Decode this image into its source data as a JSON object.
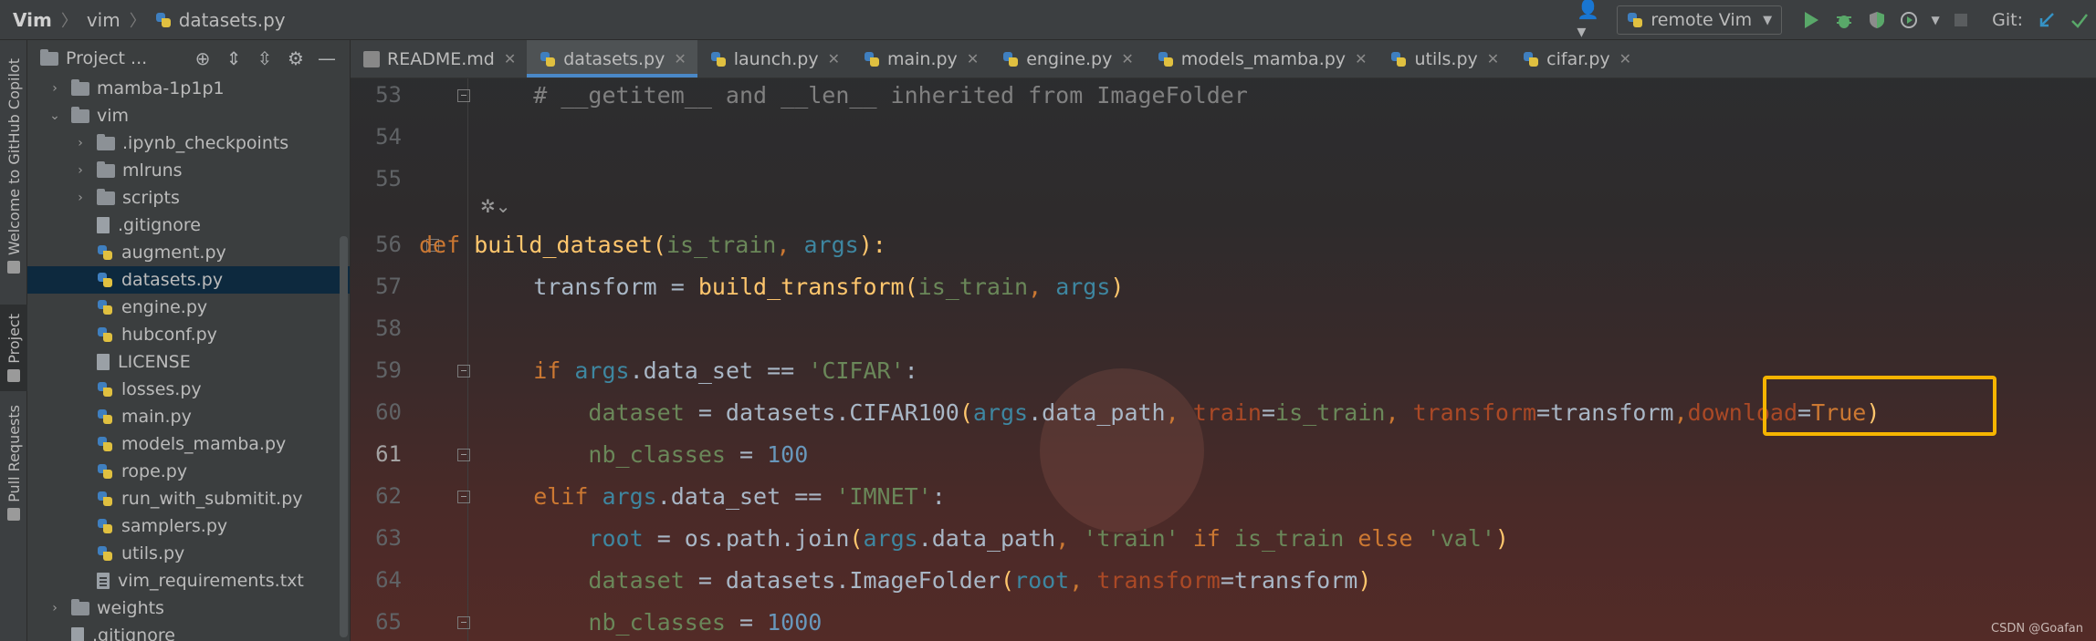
{
  "navbar": {
    "breadcrumbs": [
      "Vim",
      "vim",
      "datasets.py"
    ],
    "run_config": "remote Vim",
    "git_label": "Git:"
  },
  "toolwindows": {
    "left": [
      "Welcome to GitHub Copilot",
      "Project",
      "Pull Requests"
    ]
  },
  "project_panel": {
    "title": "Project ...",
    "tree": [
      {
        "label": "mamba-1p1p1",
        "type": "folder",
        "depth": 1,
        "expanded": false
      },
      {
        "label": "vim",
        "type": "folder",
        "depth": 1,
        "expanded": true
      },
      {
        "label": ".ipynb_checkpoints",
        "type": "folder",
        "depth": 2,
        "expanded": false
      },
      {
        "label": "mlruns",
        "type": "folder",
        "depth": 2,
        "expanded": false
      },
      {
        "label": "scripts",
        "type": "folder",
        "depth": 2,
        "expanded": false
      },
      {
        "label": ".gitignore",
        "type": "file",
        "depth": 2
      },
      {
        "label": "augment.py",
        "type": "py",
        "depth": 2
      },
      {
        "label": "datasets.py",
        "type": "py",
        "depth": 2,
        "selected": true
      },
      {
        "label": "engine.py",
        "type": "py",
        "depth": 2
      },
      {
        "label": "hubconf.py",
        "type": "py",
        "depth": 2
      },
      {
        "label": "LICENSE",
        "type": "file",
        "depth": 2
      },
      {
        "label": "losses.py",
        "type": "py",
        "depth": 2
      },
      {
        "label": "main.py",
        "type": "py",
        "depth": 2
      },
      {
        "label": "models_mamba.py",
        "type": "py",
        "depth": 2
      },
      {
        "label": "rope.py",
        "type": "py",
        "depth": 2
      },
      {
        "label": "run_with_submitit.py",
        "type": "py",
        "depth": 2
      },
      {
        "label": "samplers.py",
        "type": "py",
        "depth": 2
      },
      {
        "label": "utils.py",
        "type": "py",
        "depth": 2
      },
      {
        "label": "vim_requirements.txt",
        "type": "txt",
        "depth": 2
      },
      {
        "label": "weights",
        "type": "folder",
        "depth": 1,
        "expanded": false
      },
      {
        "label": ".gitignore",
        "type": "file",
        "depth": 1
      }
    ]
  },
  "tabs": [
    {
      "label": "README.md",
      "icon": "markdown-icon"
    },
    {
      "label": "datasets.py",
      "icon": "python-icon",
      "active": true
    },
    {
      "label": "launch.py",
      "icon": "python-icon"
    },
    {
      "label": "main.py",
      "icon": "python-icon"
    },
    {
      "label": "engine.py",
      "icon": "python-icon"
    },
    {
      "label": "models_mamba.py",
      "icon": "python-icon"
    },
    {
      "label": "utils.py",
      "icon": "python-icon"
    },
    {
      "label": "cifar.py",
      "icon": "python-icon"
    }
  ],
  "code": {
    "current_line": 61,
    "lines": [
      {
        "n": 53,
        "tokens": [
          [
            "    ",
            "plain"
          ],
          [
            "# __getitem__ and __len__ inherited from ImageFolder",
            "com"
          ]
        ]
      },
      {
        "n": 54,
        "tokens": []
      },
      {
        "n": 55,
        "tokens": []
      },
      {
        "n": 56,
        "tokens": [
          [
            "def ",
            "kw"
          ],
          [
            "build_dataset",
            "fn"
          ],
          [
            "(",
            "fn"
          ],
          [
            "is_train",
            "param"
          ],
          [
            ", ",
            "kw"
          ],
          [
            "args",
            "argv"
          ],
          [
            "):",
            "fn"
          ]
        ]
      },
      {
        "n": 57,
        "tokens": [
          [
            "    transform = ",
            "plain"
          ],
          [
            "build_transform",
            "fn"
          ],
          [
            "(",
            "fn"
          ],
          [
            "is_train",
            "param"
          ],
          [
            ", ",
            "kw"
          ],
          [
            "args",
            "argv"
          ],
          [
            ")",
            "fn"
          ]
        ]
      },
      {
        "n": 58,
        "tokens": []
      },
      {
        "n": 59,
        "tokens": [
          [
            "    ",
            "plain"
          ],
          [
            "if ",
            "kw"
          ],
          [
            "args",
            "argv"
          ],
          [
            ".data_set == ",
            "plain"
          ],
          [
            "'CIFAR'",
            "str"
          ],
          [
            ":",
            "plain"
          ]
        ]
      },
      {
        "n": 60,
        "tokens": [
          [
            "        ",
            "plain"
          ],
          [
            "dataset",
            "param"
          ],
          [
            " = datasets.CIFAR100",
            "plain"
          ],
          [
            "(",
            "fn"
          ],
          [
            "args",
            "argv"
          ],
          [
            ".data_path",
            "plain"
          ],
          [
            ", ",
            "kw"
          ],
          [
            "train",
            "named"
          ],
          [
            "=",
            "plain"
          ],
          [
            "is_train",
            "param"
          ],
          [
            ", ",
            "kw"
          ],
          [
            "transform",
            "named"
          ],
          [
            "=transform",
            "plain"
          ],
          [
            ",",
            "kw"
          ],
          [
            "download",
            "named"
          ],
          [
            "=",
            "plain"
          ],
          [
            "True",
            "kw"
          ],
          [
            ")",
            "fn"
          ]
        ]
      },
      {
        "n": 61,
        "tokens": [
          [
            "        ",
            "plain"
          ],
          [
            "nb_classes",
            "param"
          ],
          [
            " = ",
            "plain"
          ],
          [
            "100",
            "num"
          ]
        ]
      },
      {
        "n": 62,
        "tokens": [
          [
            "    ",
            "plain"
          ],
          [
            "elif ",
            "kw"
          ],
          [
            "args",
            "argv"
          ],
          [
            ".data_set == ",
            "plain"
          ],
          [
            "'IMNET'",
            "str"
          ],
          [
            ":",
            "plain"
          ]
        ]
      },
      {
        "n": 63,
        "tokens": [
          [
            "        ",
            "plain"
          ],
          [
            "root",
            "argv"
          ],
          [
            " = os.path.join",
            "plain"
          ],
          [
            "(",
            "fn"
          ],
          [
            "args",
            "argv"
          ],
          [
            ".data_path",
            "plain"
          ],
          [
            ", ",
            "kw"
          ],
          [
            "'train'",
            "str"
          ],
          [
            " if ",
            "kw"
          ],
          [
            "is_train",
            "param"
          ],
          [
            " else ",
            "kw"
          ],
          [
            "'val'",
            "str"
          ],
          [
            ")",
            "fn"
          ]
        ]
      },
      {
        "n": 64,
        "tokens": [
          [
            "        ",
            "plain"
          ],
          [
            "dataset",
            "param"
          ],
          [
            " = datasets.ImageFolder",
            "plain"
          ],
          [
            "(",
            "fn"
          ],
          [
            "root",
            "argv"
          ],
          [
            ", ",
            "kw"
          ],
          [
            "transform",
            "named"
          ],
          [
            "=transform",
            "plain"
          ],
          [
            ")",
            "fn"
          ]
        ]
      },
      {
        "n": 65,
        "tokens": [
          [
            "        ",
            "plain"
          ],
          [
            "nb_classes",
            "param"
          ],
          [
            " = ",
            "plain"
          ],
          [
            "1000",
            "num"
          ]
        ]
      }
    ]
  },
  "watermark": "CSDN @Goafan"
}
